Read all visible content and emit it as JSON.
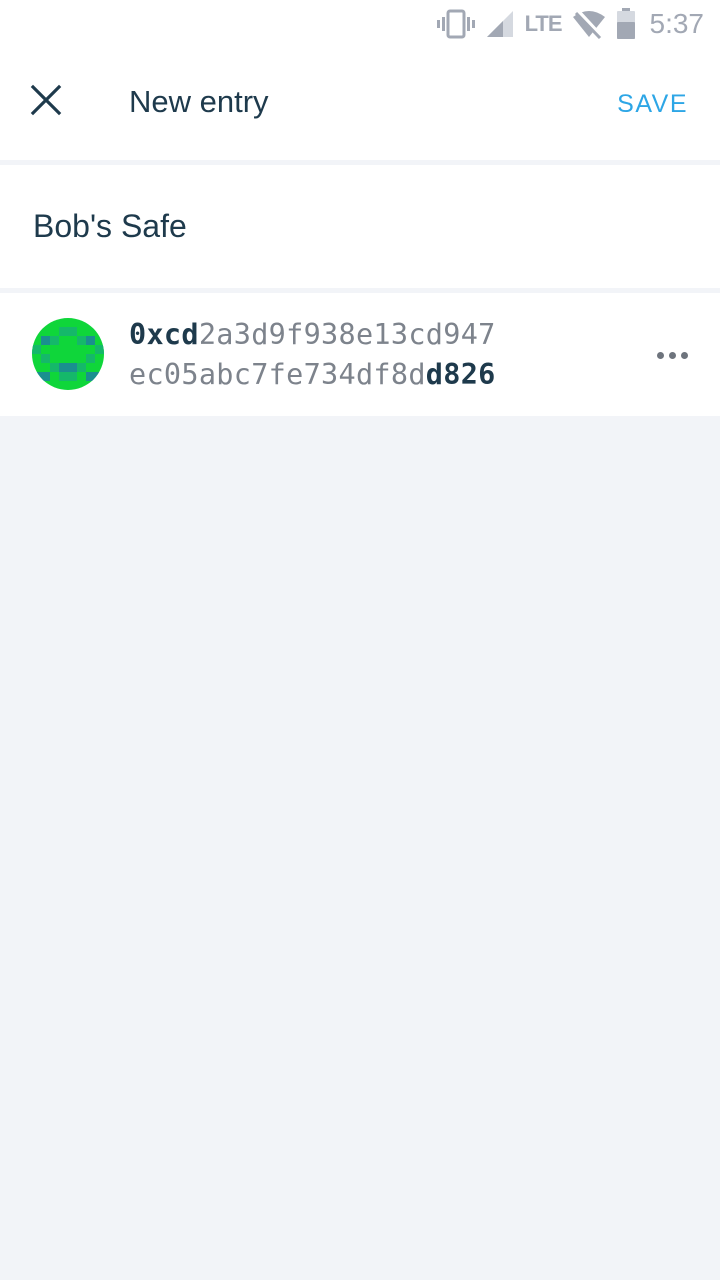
{
  "status_bar": {
    "network_label": "LTE",
    "time": "5:37",
    "icons": [
      "vibrate-icon",
      "signal-icon",
      "wifi-off-icon",
      "battery-icon"
    ]
  },
  "toolbar": {
    "title": "New entry",
    "save_label": "SAVE",
    "close_icon": "close-icon"
  },
  "entry": {
    "name_value": "Bob's Safe",
    "name_placeholder": ""
  },
  "address": {
    "line1_prefix": "0xcd",
    "line1_rest": "2a3d9f938e13cd947",
    "line2_main": "ec05abc7fe734df8d",
    "line2_suffix": "d826",
    "identicon": "identicon-avatar",
    "more_icon": "more-horizontal-icon"
  },
  "colors": {
    "accent": "#2da6e6",
    "text_primary": "#1e3a4c",
    "text_secondary": "#7d838c",
    "background": "#f2f4f8",
    "identicon_primary": "#0fd63a",
    "identicon_secondary": "#1a8f8f"
  }
}
